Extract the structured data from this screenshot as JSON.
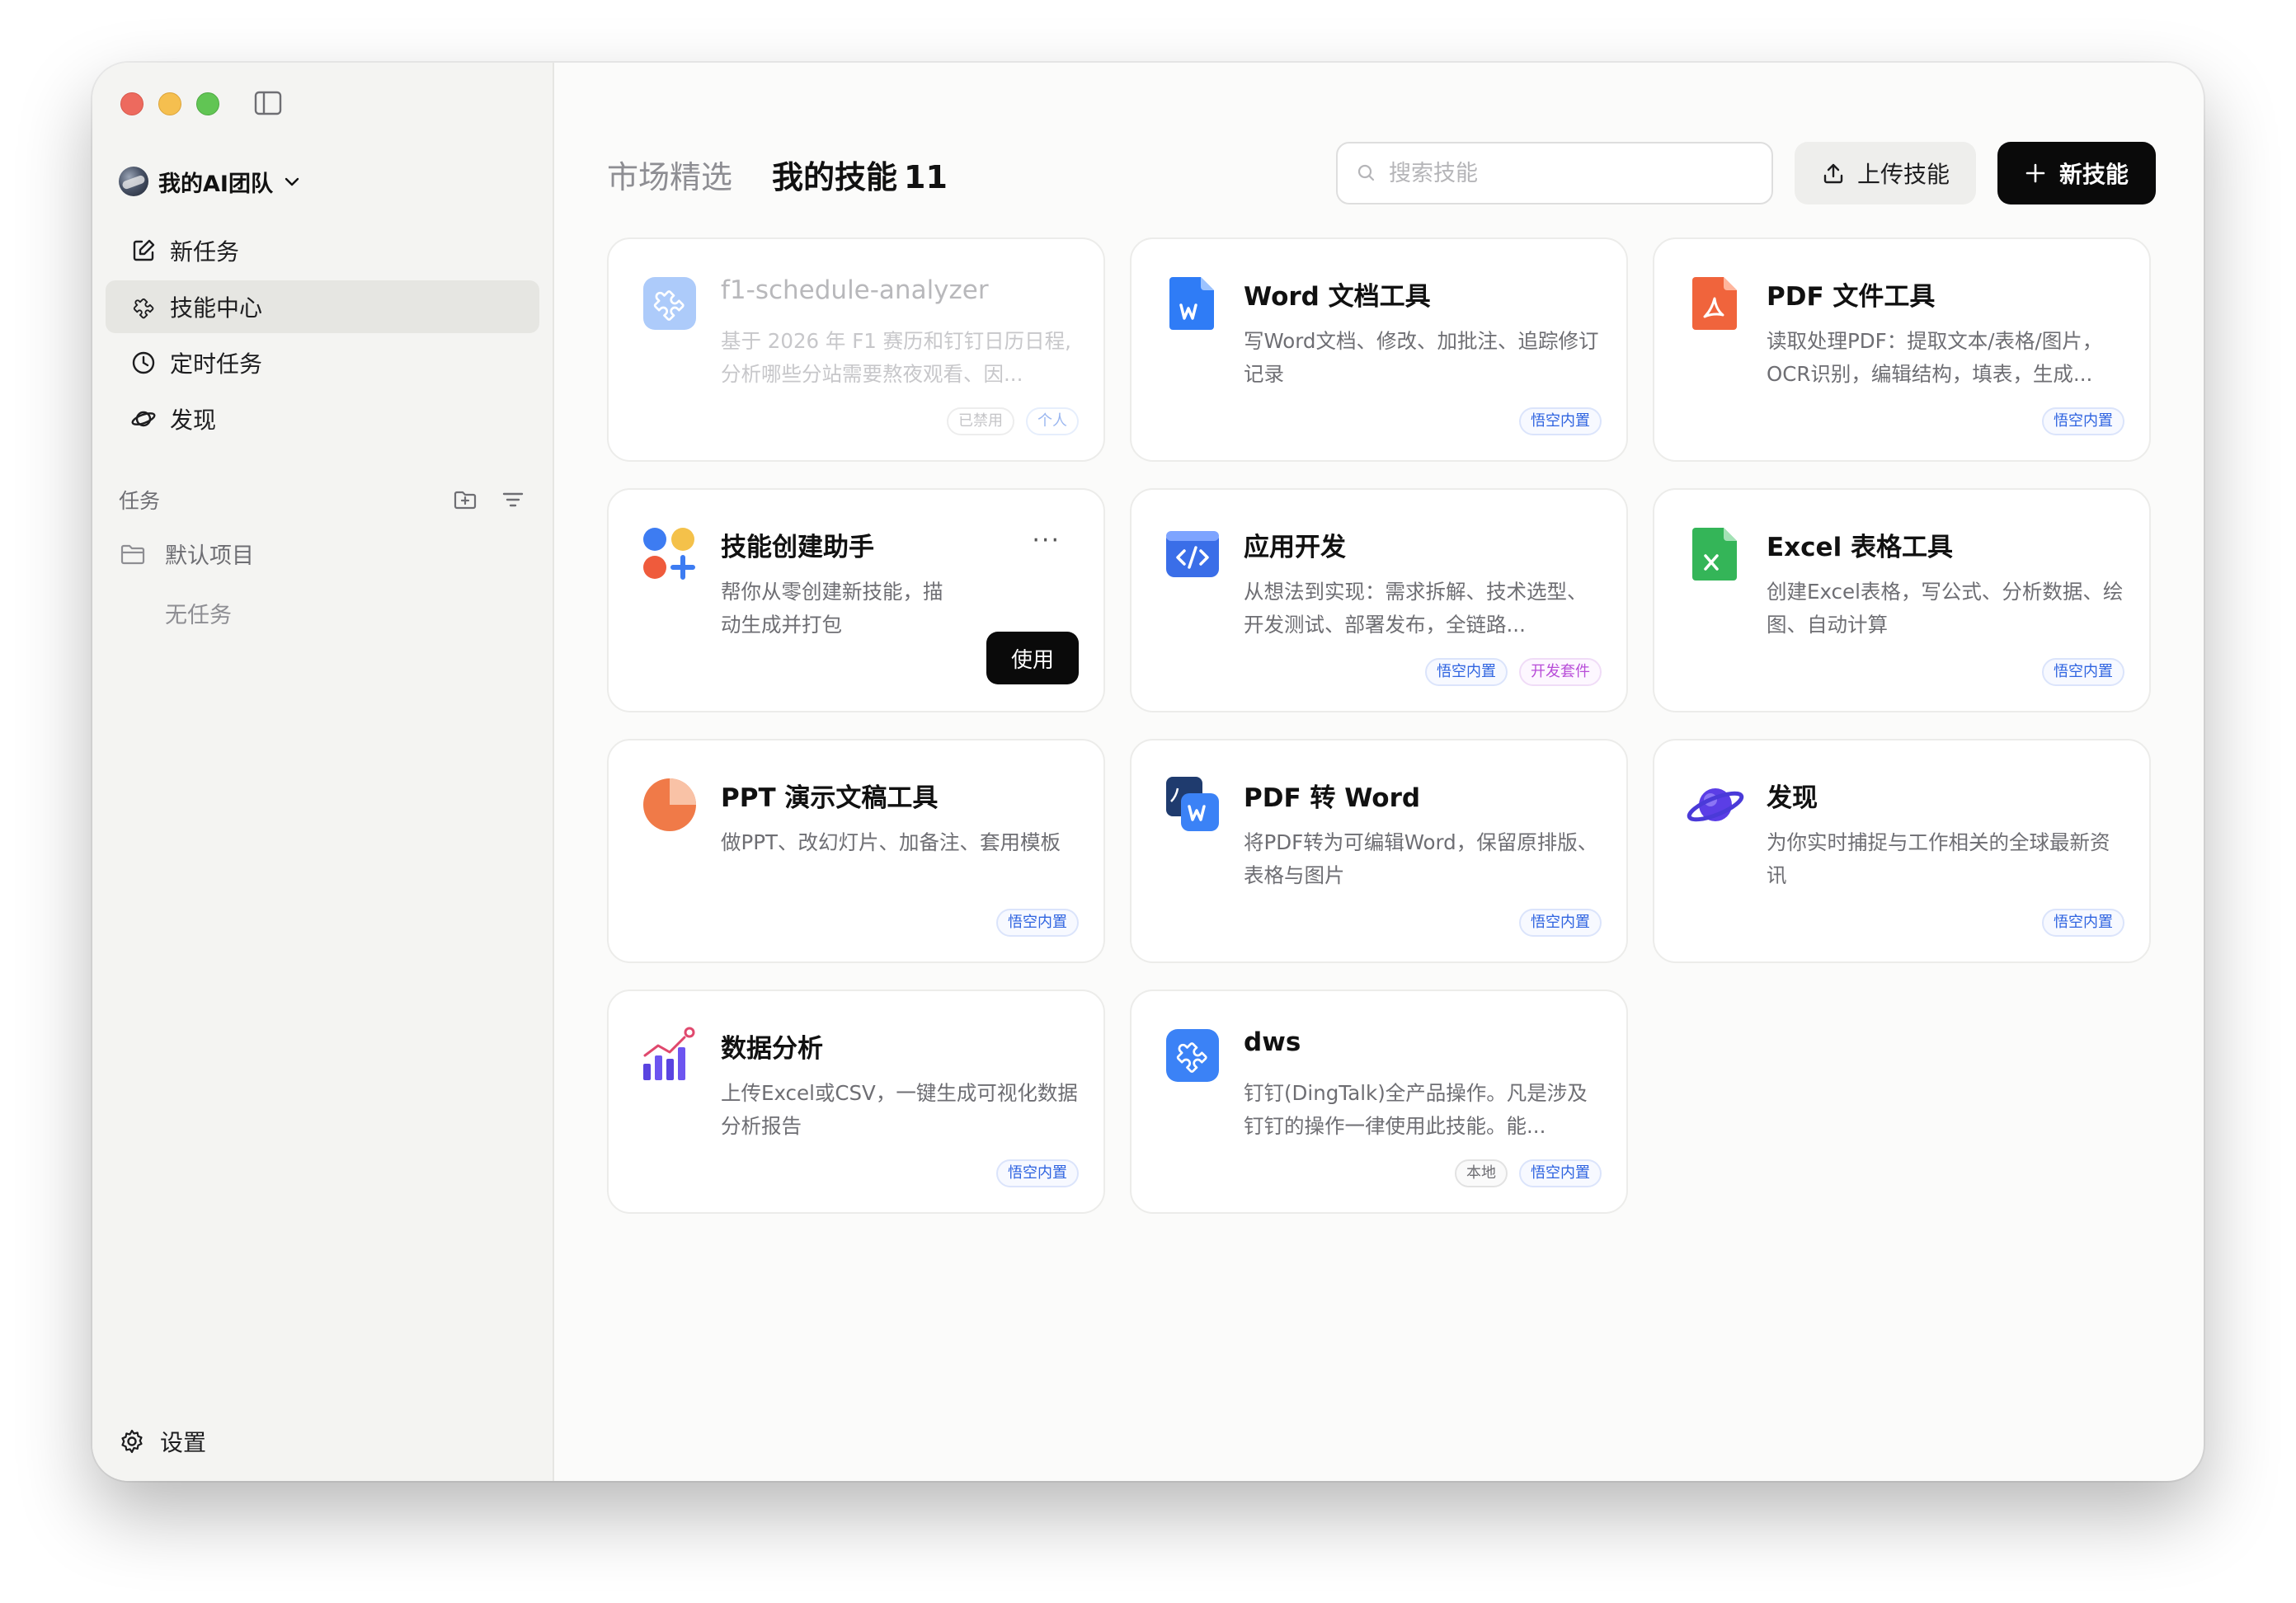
{
  "sidebar": {
    "team_name": "我的AI团队",
    "nav": [
      {
        "label": "新任务",
        "icon": "edit-icon"
      },
      {
        "label": "技能中心",
        "icon": "puzzle-icon"
      },
      {
        "label": "定时任务",
        "icon": "clock-icon"
      },
      {
        "label": "发现",
        "icon": "planet-icon"
      }
    ],
    "section_label": "任务",
    "project_name": "默认项目",
    "empty_text": "无任务",
    "settings_label": "设置"
  },
  "header": {
    "tab_market": "市场精选",
    "tab_mine": "我的技能",
    "tab_mine_count": "11",
    "search_placeholder": "搜索技能",
    "upload_label": "上传技能",
    "new_label": "新技能"
  },
  "cards": [
    {
      "title": "f1-schedule-analyzer",
      "desc": "基于 2026 年 F1 赛历和钉钉日历日程,分析哪些分站需要熬夜观看、因...",
      "icon": "puzzle-icon",
      "tags": [
        "已禁用",
        "个人"
      ],
      "disabled": true
    },
    {
      "title": "Word 文档工具",
      "desc": "写Word文档、修改、加批注、追踪修订记录",
      "icon": "word-file-icon",
      "tags": [
        "悟空内置"
      ]
    },
    {
      "title": "PDF 文件工具",
      "desc": "读取处理PDF：提取文本/表格/图片，OCR识别，编辑结构，填表，生成...",
      "icon": "pdf-file-icon",
      "tags": [
        "悟空内置"
      ]
    },
    {
      "title": "技能创建助手",
      "desc": "帮你从零创建新技能，描动生成并打包",
      "icon": "skill-creator-icon",
      "more": "···",
      "action": "使用"
    },
    {
      "title": "应用开发",
      "desc": "从想法到实现：需求拆解、技术选型、开发测试、部署发布，全链路...",
      "icon": "code-window-icon",
      "tags": [
        "悟空内置",
        "开发套件"
      ]
    },
    {
      "title": "Excel 表格工具",
      "desc": "创建Excel表格，写公式、分析数据、绘图、自动计算",
      "icon": "excel-file-icon",
      "tags": [
        "悟空内置"
      ]
    },
    {
      "title": "PPT 演示文稿工具",
      "desc": "做PPT、改幻灯片、加备注、套用模板",
      "icon": "ppt-pie-icon",
      "tags": [
        "悟空内置"
      ]
    },
    {
      "title": "PDF 转 Word",
      "desc": "将PDF转为可编辑Word，保留原排版、表格与图片",
      "icon": "pdf-to-word-icon",
      "tags": [
        "悟空内置"
      ]
    },
    {
      "title": "发现",
      "desc": "为你实时捕捉与工作相关的全球最新资讯",
      "icon": "planet-icon",
      "tags": [
        "悟空内置"
      ]
    },
    {
      "title": "数据分析",
      "desc": "上传Excel或CSV，一键生成可视化数据分析报告",
      "icon": "bar-chart-icon",
      "tags": [
        "悟空内置"
      ]
    },
    {
      "title": "dws",
      "desc": "钉钉(DingTalk)全产品操作。凡是涉及钉钉的操作一律使用此技能。能...",
      "icon": "puzzle-icon",
      "tags": [
        "本地",
        "悟空内置"
      ]
    }
  ]
}
